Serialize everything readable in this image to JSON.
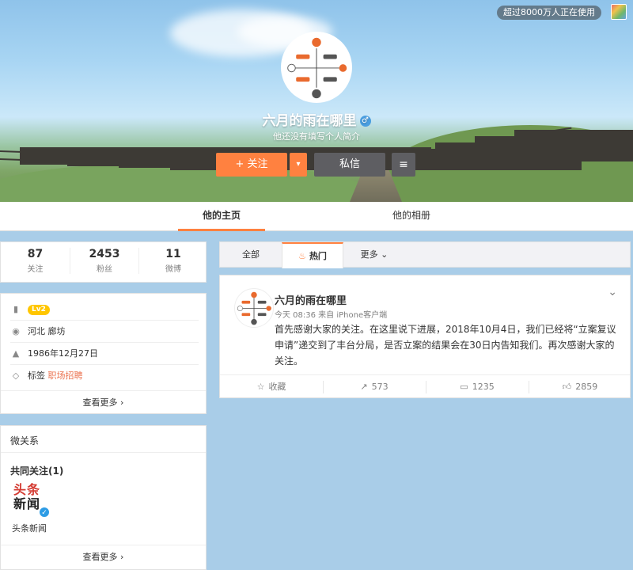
{
  "top": {
    "usage_badge": "超过8000万人正在使用"
  },
  "profile": {
    "name": "六月的雨在哪里",
    "gender_symbol": "♂",
    "bio": "他还没有填写个人简介",
    "follow_label": "+ 关注",
    "dropdown_symbol": "▾",
    "message_label": "私信",
    "menu_symbol": "≡"
  },
  "tabs": {
    "home": "他的主页",
    "album": "他的相册"
  },
  "stats": [
    {
      "num": "87",
      "label": "关注"
    },
    {
      "num": "2453",
      "label": "粉丝"
    },
    {
      "num": "11",
      "label": "微博"
    }
  ],
  "info": {
    "level": "Lv2",
    "location": "河北 廊坊",
    "birthday": "1986年12月27日",
    "tags_label": "标签",
    "tag": "职场招聘",
    "more": "查看更多 ›"
  },
  "relations": {
    "title": "微关系",
    "common_follow": "共同关注(1)",
    "logo_line1": "头条",
    "logo_line2": "新闻",
    "item_name": "头条新闻",
    "more": "查看更多 ›"
  },
  "filters": {
    "all": "全部",
    "hot": "热门",
    "more": "更多 ⌄"
  },
  "post": {
    "name": "六月的雨在哪里",
    "meta": "今天 08:36 来自 iPhone客户端",
    "text": "首先感谢大家的关注。在这里说下进展，2018年10月4日，我们已经将“立案复议申请”递交到了丰台分局，是否立案的结果会在30日内告知我们。再次感谢大家的关注。",
    "actions": {
      "collect": "收藏",
      "repost": "573",
      "comment": "1235",
      "like": "2859"
    }
  },
  "colors": {
    "accent": "#ff8140",
    "dark_button": "#5e5e62",
    "link": "#eb7350"
  }
}
